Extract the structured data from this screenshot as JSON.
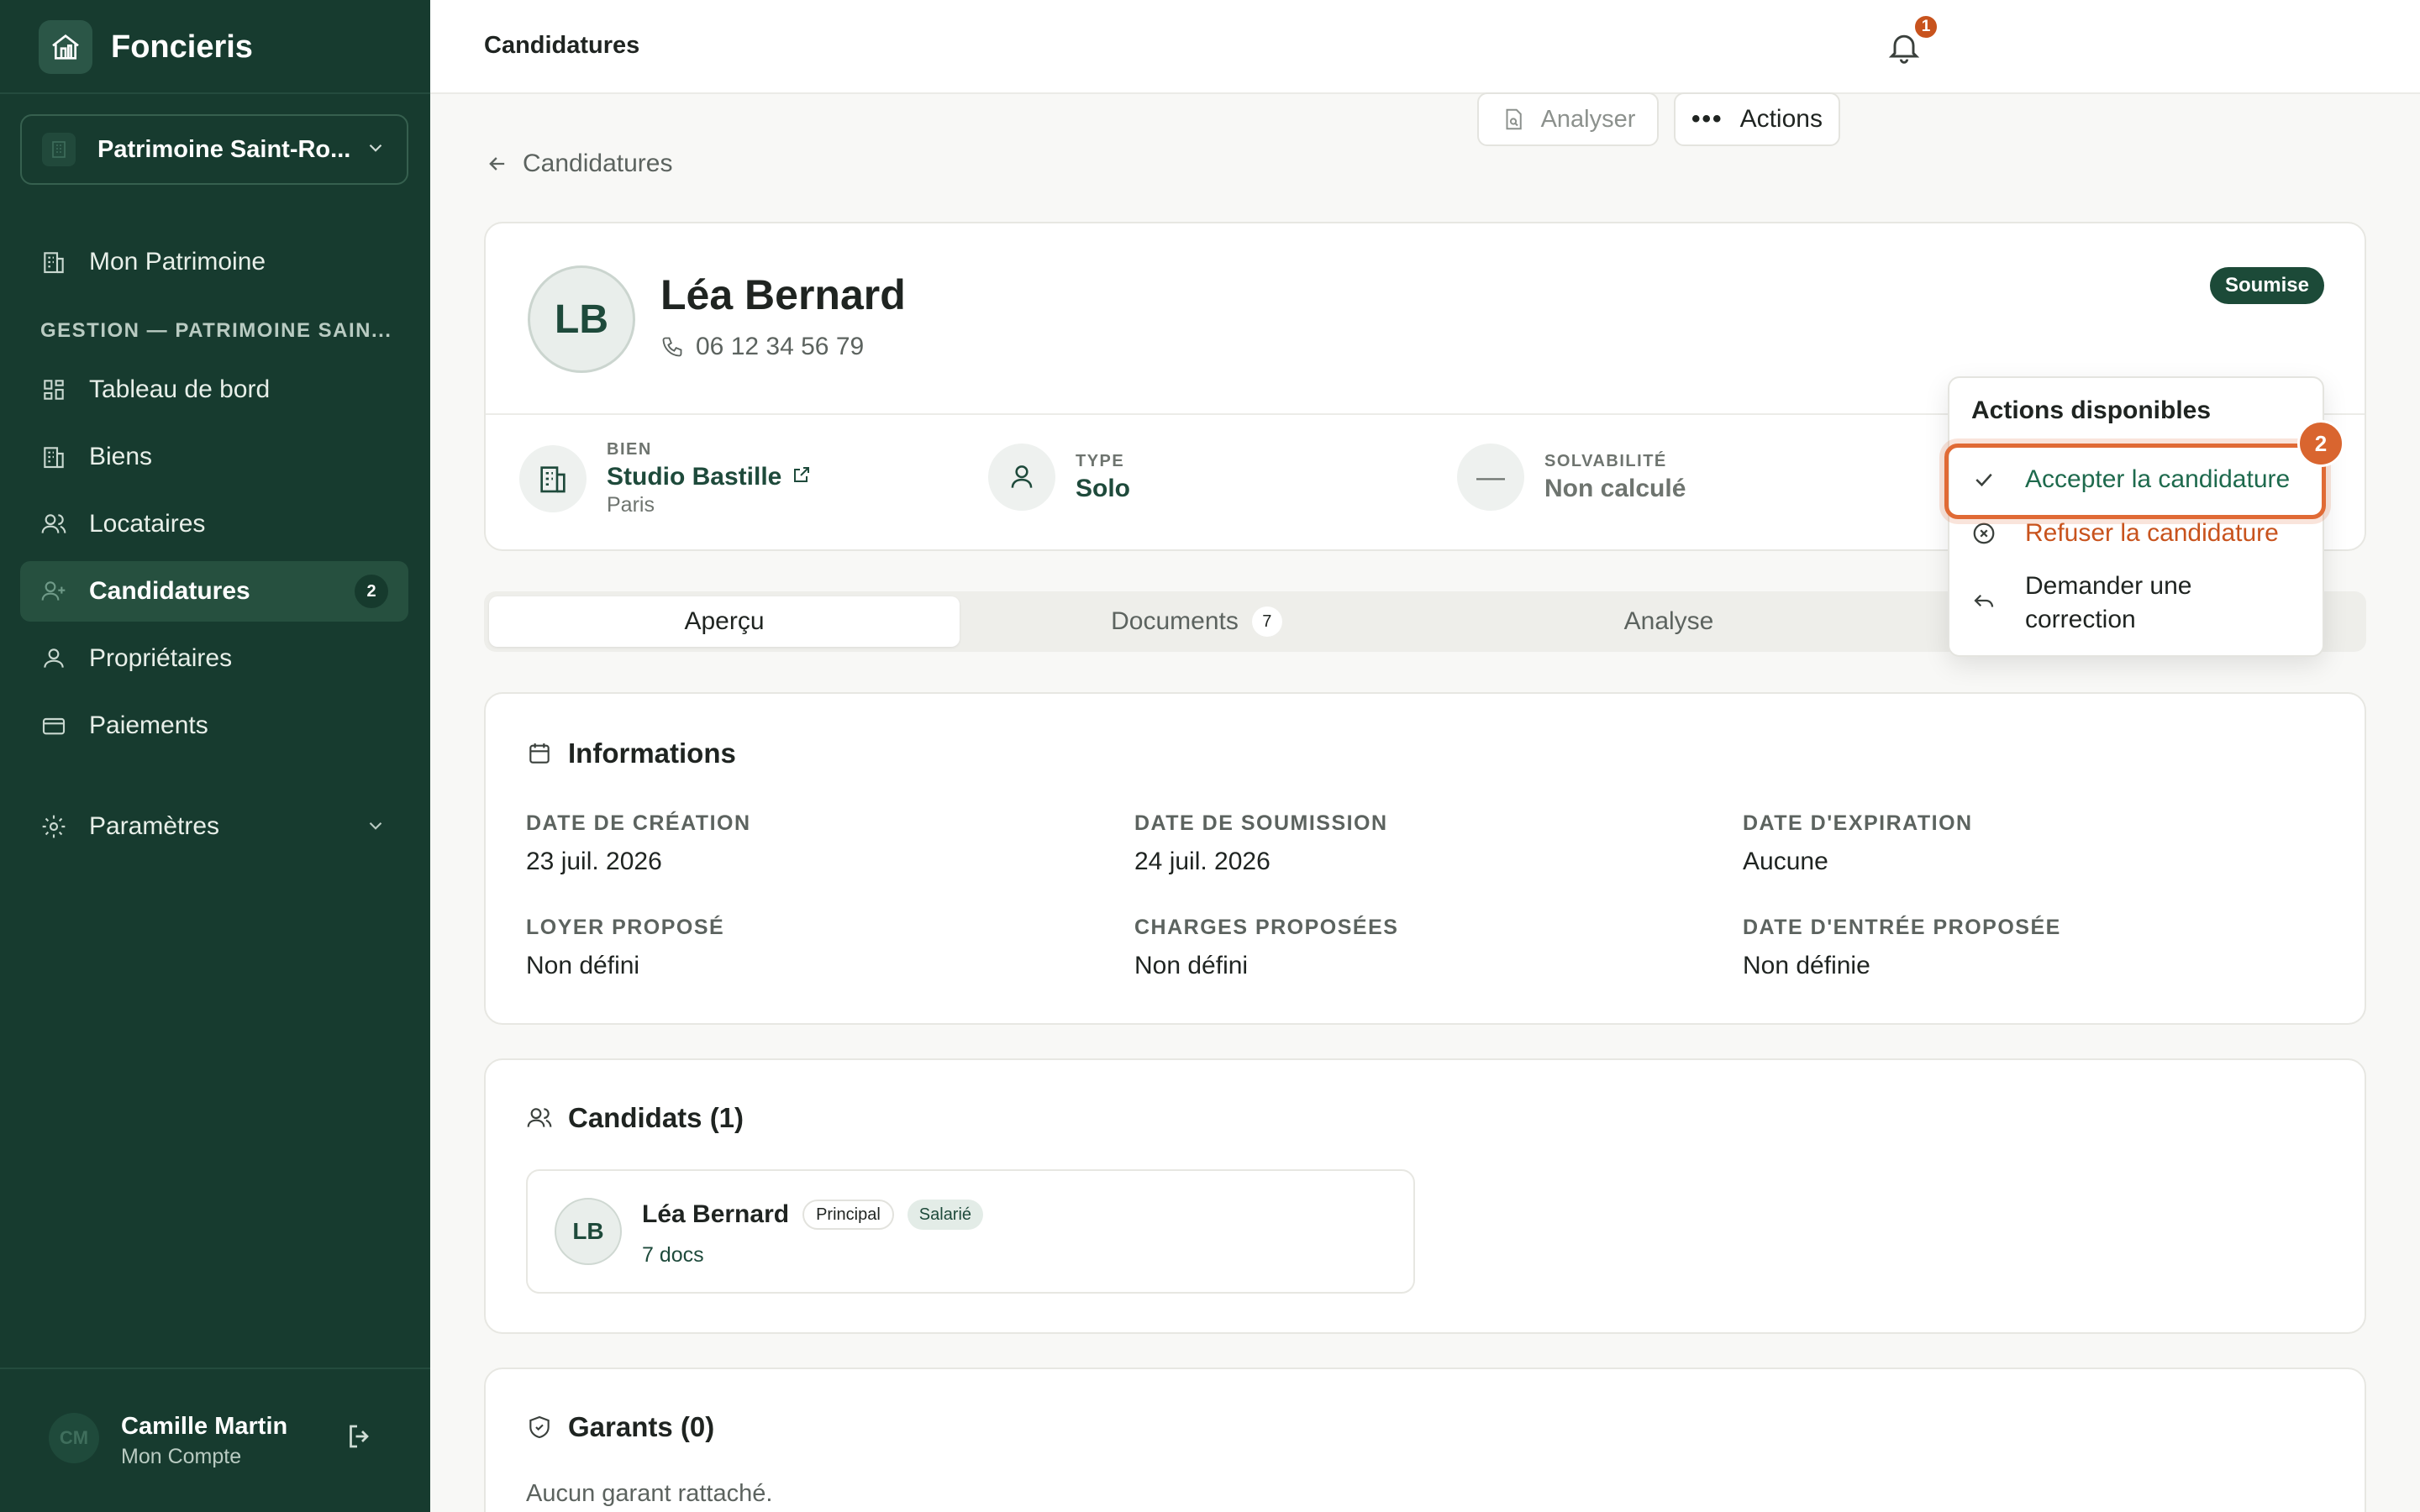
{
  "app": {
    "name": "Foncieris",
    "organization": "Patrimoine Saint-Ro..."
  },
  "sidebar": {
    "top_item": "Mon Patrimoine",
    "section_label": "GESTION — PATRIMOINE SAIN...",
    "items": [
      {
        "label": "Tableau de bord",
        "icon": "dashboard-icon"
      },
      {
        "label": "Biens",
        "icon": "building-icon"
      },
      {
        "label": "Locataires",
        "icon": "users-icon"
      },
      {
        "label": "Candidatures",
        "icon": "user-plus-icon",
        "badge": "2",
        "active": true
      },
      {
        "label": "Propriétaires",
        "icon": "user-icon"
      },
      {
        "label": "Paiements",
        "icon": "card-icon"
      }
    ],
    "settings": "Paramètres",
    "user": {
      "initials": "CM",
      "name": "Camille Martin",
      "subtitle": "Mon Compte"
    }
  },
  "topbar": {
    "title": "Candidatures",
    "notification_count": "1"
  },
  "main": {
    "back_label": "Candidatures",
    "candidate": {
      "initials": "LB",
      "name": "Léa Bernard",
      "phone": "06 12 34 56 79",
      "status": "Soumise"
    },
    "buttons": {
      "analyser": "Analyser",
      "actions": "Actions"
    },
    "summary": {
      "bien": {
        "label": "BIEN",
        "value": "Studio Bastille",
        "sub": "Paris"
      },
      "type": {
        "label": "TYPE",
        "value": "Solo"
      },
      "solvabilite": {
        "label": "SOLVABILITÉ",
        "value": "Non calculé",
        "placeholder": "—"
      }
    },
    "tabs": [
      {
        "label": "Aperçu",
        "active": true
      },
      {
        "label": "Documents",
        "count": "7"
      },
      {
        "label": "Analyse"
      }
    ],
    "informations": {
      "title": "Informations",
      "fields": [
        {
          "label": "DATE DE CRÉATION",
          "value": "23 juil. 2026"
        },
        {
          "label": "DATE DE SOUMISSION",
          "value": "24 juil. 2026"
        },
        {
          "label": "DATE D'EXPIRATION",
          "value": "Aucune"
        },
        {
          "label": "LOYER PROPOSÉ",
          "value": "Non défini"
        },
        {
          "label": "CHARGES PROPOSÉES",
          "value": "Non défini"
        },
        {
          "label": "DATE D'ENTRÉE PROPOSÉE",
          "value": "Non définie"
        }
      ]
    },
    "candidats": {
      "title": "Candidats (1)",
      "items": [
        {
          "initials": "LB",
          "name": "Léa Bernard",
          "role": "Principal",
          "status": "Salarié",
          "docs": "7 docs"
        }
      ]
    },
    "garants": {
      "title": "Garants (0)",
      "empty": "Aucun garant rattaché."
    }
  },
  "dropdown": {
    "title": "Actions disponibles",
    "accept": "Accepter la candidature",
    "refuse": "Refuser la candidature",
    "correct_line1": "Demander une",
    "correct_line2": "correction",
    "step": "2"
  },
  "colors": {
    "sidebar_bg": "#173b2f",
    "accent_green": "#1e4a3b",
    "accent_orange": "#c8531d"
  }
}
